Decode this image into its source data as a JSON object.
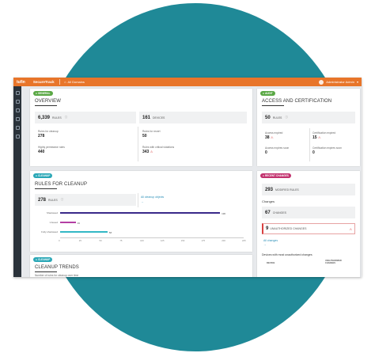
{
  "topbar": {
    "logo": "tufin",
    "product": "SecureTrack",
    "context": "All Domains",
    "user": "Administrator Admin"
  },
  "general": {
    "tag": "GENERAL",
    "title": "OVERVIEW",
    "rules_value": "6,339",
    "rules_label": "RULES",
    "devices_value": "161",
    "devices_label": "DEVICES",
    "rules_cleanup_label": "Rules for cleanup",
    "rules_cleanup_value": "278",
    "rules_recert_label": "Rules for recert",
    "rules_recert_value": "50",
    "highly_perm_label": "Highly permissive rules",
    "highly_perm_value": "440",
    "critical_viol_label": "Rules with critical violations",
    "critical_viol_value": "343"
  },
  "audit": {
    "tag": "AUDIT",
    "title": "ACCESS AND CERTIFICATION",
    "rules_value": "50",
    "rules_label": "RULES",
    "access_expired_label": "Access expired",
    "access_expired_value": "38",
    "cert_expired_label": "Certification expired",
    "cert_expired_value": "15",
    "access_soon_label": "Access expires soon",
    "access_soon_value": "0",
    "cert_soon_label": "Certification expires soon",
    "cert_soon_value": "0"
  },
  "cleanup": {
    "tag": "CLEANUP",
    "title": "RULES FOR CLEANUP",
    "rules_value": "278",
    "rules_label": "RULES",
    "link_label": "All cleanup objects",
    "bars": [
      {
        "label": "Shadowed",
        "value": 196,
        "value_label": "196",
        "color": "#3a2a8a"
      },
      {
        "label": "Unused",
        "value": 19,
        "value_label": "19",
        "color": "#b43fa3"
      },
      {
        "label": "Fully shadowed",
        "value": 58,
        "value_label": "58",
        "color": "#33b8c5"
      }
    ],
    "axis_ticks": [
      "0",
      "25",
      "50",
      "75",
      "100",
      "125",
      "150",
      "175",
      "200",
      "225"
    ],
    "axis_max": 225
  },
  "trends": {
    "tag": "CLEANUP",
    "title": "CLEANUP TRENDS",
    "subtitle": "Number of rules for cleanup over time"
  },
  "changes": {
    "tag": "RECENT CHANGES",
    "modified_value": "293",
    "modified_label": "MODIFIED RULES",
    "changes_heading": "Changes",
    "changes_value": "67",
    "changes_label": "CHANGES",
    "unauth_value": "9",
    "unauth_label": "UNAUTHORIZED CHANGES",
    "link_label": "All changes",
    "devices_heading": "Devices with most unauthorized changes",
    "col_device": "DEVICE",
    "col_unauth": "UNAUTHORIZED CHANGES"
  },
  "colors": {
    "orange": "#e8752a",
    "green_tag": "#5aa845",
    "teal_tag": "#2aa7b6",
    "magenta_tag": "#c2326e",
    "red": "#d94040",
    "teal_bg": "#1f8997"
  }
}
